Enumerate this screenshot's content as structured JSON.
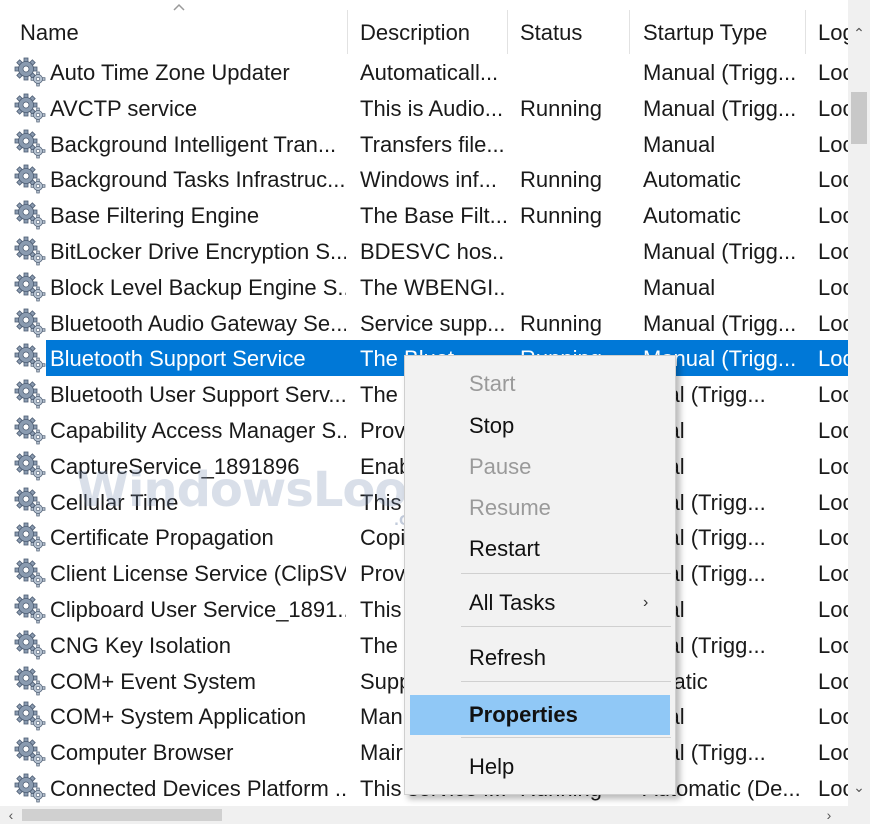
{
  "columns": [
    {
      "key": "name",
      "label": "Name"
    },
    {
      "key": "desc",
      "label": "Description"
    },
    {
      "key": "status",
      "label": "Status"
    },
    {
      "key": "startup",
      "label": "Startup Type"
    },
    {
      "key": "logon",
      "label": "Log"
    }
  ],
  "rows": [
    {
      "name": "Auto Time Zone Updater",
      "desc": "Automaticall...",
      "status": "",
      "startup": "Manual (Trigg...",
      "logon": "Loc"
    },
    {
      "name": "AVCTP service",
      "desc": "This is Audio...",
      "status": "Running",
      "startup": "Manual (Trigg...",
      "logon": "Loc"
    },
    {
      "name": "Background Intelligent Tran...",
      "desc": "Transfers file...",
      "status": "",
      "startup": "Manual",
      "logon": "Loc"
    },
    {
      "name": "Background Tasks Infrastruc...",
      "desc": "Windows inf...",
      "status": "Running",
      "startup": "Automatic",
      "logon": "Loc"
    },
    {
      "name": "Base Filtering Engine",
      "desc": "The Base Filt...",
      "status": "Running",
      "startup": "Automatic",
      "logon": "Loc"
    },
    {
      "name": "BitLocker Drive Encryption S...",
      "desc": "BDESVC hos...",
      "status": "",
      "startup": "Manual (Trigg...",
      "logon": "Loc"
    },
    {
      "name": "Block Level Backup Engine S...",
      "desc": "The WBENGI...",
      "status": "",
      "startup": "Manual",
      "logon": "Loc"
    },
    {
      "name": "Bluetooth Audio Gateway Se...",
      "desc": "Service supp...",
      "status": "Running",
      "startup": "Manual (Trigg...",
      "logon": "Loc"
    },
    {
      "name": "Bluetooth Support Service",
      "desc": "The Bluet...",
      "status": "Running",
      "startup": "Manual (Trigg...",
      "logon": "Loc",
      "selected": true
    },
    {
      "name": "Bluetooth User Support Serv...",
      "desc": "The",
      "status": "",
      "startup": "nual (Trigg...",
      "logon": "Loc"
    },
    {
      "name": "Capability Access Manager S...",
      "desc": "Prov",
      "status": "",
      "startup": "nual",
      "logon": "Loc"
    },
    {
      "name": "CaptureService_1891896",
      "desc": "Enab",
      "status": "",
      "startup": "nual",
      "logon": "Loc"
    },
    {
      "name": "Cellular Time",
      "desc": "This",
      "status": "",
      "startup": "nual (Trigg...",
      "logon": "Loc"
    },
    {
      "name": "Certificate Propagation",
      "desc": "Copi",
      "status": "",
      "startup": "nual (Trigg...",
      "logon": "Loc"
    },
    {
      "name": "Client License Service (ClipSV...",
      "desc": "Prov",
      "status": "",
      "startup": "nual (Trigg...",
      "logon": "Loc"
    },
    {
      "name": "Clipboard User Service_1891...",
      "desc": "This",
      "status": "",
      "startup": "nual",
      "logon": "Loc"
    },
    {
      "name": "CNG Key Isolation",
      "desc": "The",
      "status": "",
      "startup": "nual (Trigg...",
      "logon": "Loc"
    },
    {
      "name": "COM+ Event System",
      "desc": "Supp",
      "status": "",
      "startup": "omatic",
      "logon": "Loc"
    },
    {
      "name": "COM+ System Application",
      "desc": "Man",
      "status": "",
      "startup": "nual",
      "logon": "Loc"
    },
    {
      "name": "Computer Browser",
      "desc": "Mair",
      "status": "",
      "startup": "nual (Trigg...",
      "logon": "Loc"
    },
    {
      "name": "Connected Devices Platform ...",
      "desc": "This service i...",
      "status": "Running",
      "startup": "Automatic (De...",
      "logon": "Loc"
    }
  ],
  "context_menu": {
    "items": [
      {
        "label": "Start",
        "disabled": true
      },
      {
        "label": "Stop",
        "disabled": false
      },
      {
        "label": "Pause",
        "disabled": true
      },
      {
        "label": "Resume",
        "disabled": true
      },
      {
        "label": "Restart",
        "disabled": false
      },
      {
        "separator": true
      },
      {
        "label": "All Tasks",
        "submenu": true
      },
      {
        "separator": true
      },
      {
        "label": "Refresh"
      },
      {
        "separator": true
      },
      {
        "label": "Properties",
        "bold": true,
        "highlighted": true
      },
      {
        "separator": true
      },
      {
        "label": "Help"
      }
    ],
    "submenu_glyph": "›"
  },
  "watermark": {
    "text": "WindowsLoop",
    "suffix": ".COM"
  },
  "icons": {
    "service": "gear-icon",
    "sort": "sort-up-icon"
  },
  "colors": {
    "selection": "#0078d7",
    "menu_hover": "#90c8f6",
    "menu_bg": "#f2f2f2"
  },
  "scroll": {
    "up": "⌃",
    "down": "⌄",
    "left": "‹",
    "right": "›"
  }
}
